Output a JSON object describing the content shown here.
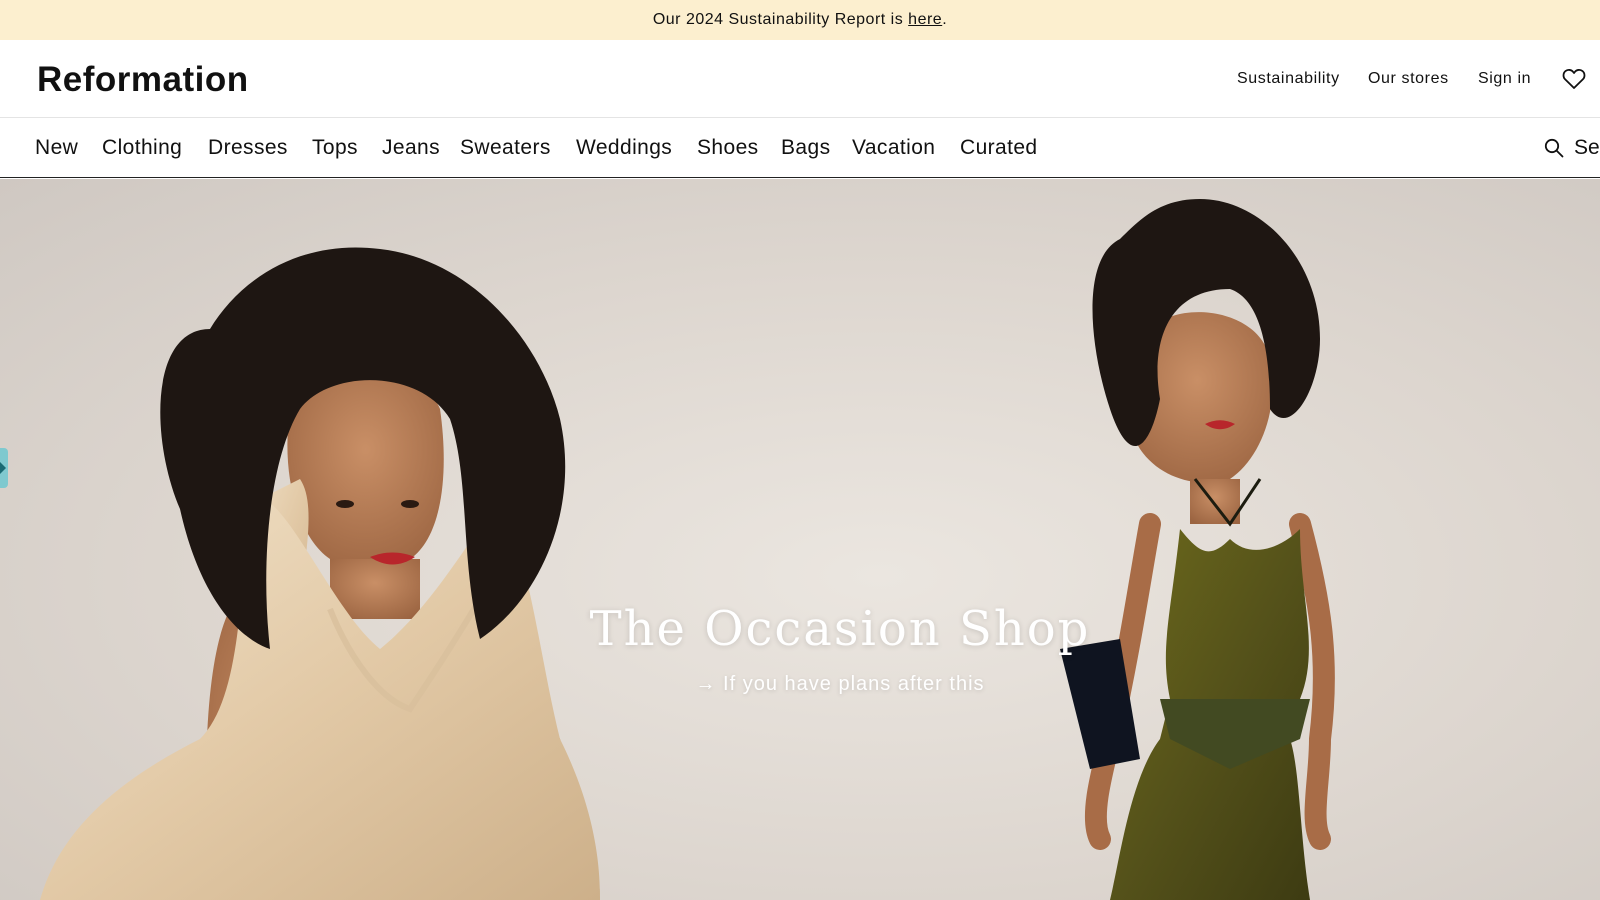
{
  "announcement": {
    "prefix": "Our 2024 Sustainability Report is ",
    "link": "here",
    "suffix": "."
  },
  "header": {
    "logo": "Reformation",
    "utility": [
      "Sustainability",
      "Our stores",
      "Sign in"
    ],
    "wishlist_icon": "heart-icon"
  },
  "nav": {
    "items": [
      "New",
      "Clothing",
      "Dresses",
      "Tops",
      "Jeans",
      "Sweaters",
      "Weddings",
      "Shoes",
      "Bags",
      "Vacation",
      "Curated"
    ],
    "search_icon": "search-icon",
    "search_label": "Se"
  },
  "hero": {
    "title": "The Occasion Shop",
    "arrow": "→",
    "subtitle": "If you have plans after this"
  },
  "colors": {
    "announcement_bg": "#fcefcf",
    "hero_bg": "#e3ddd6",
    "edge_tab": "#7fc9cf"
  }
}
